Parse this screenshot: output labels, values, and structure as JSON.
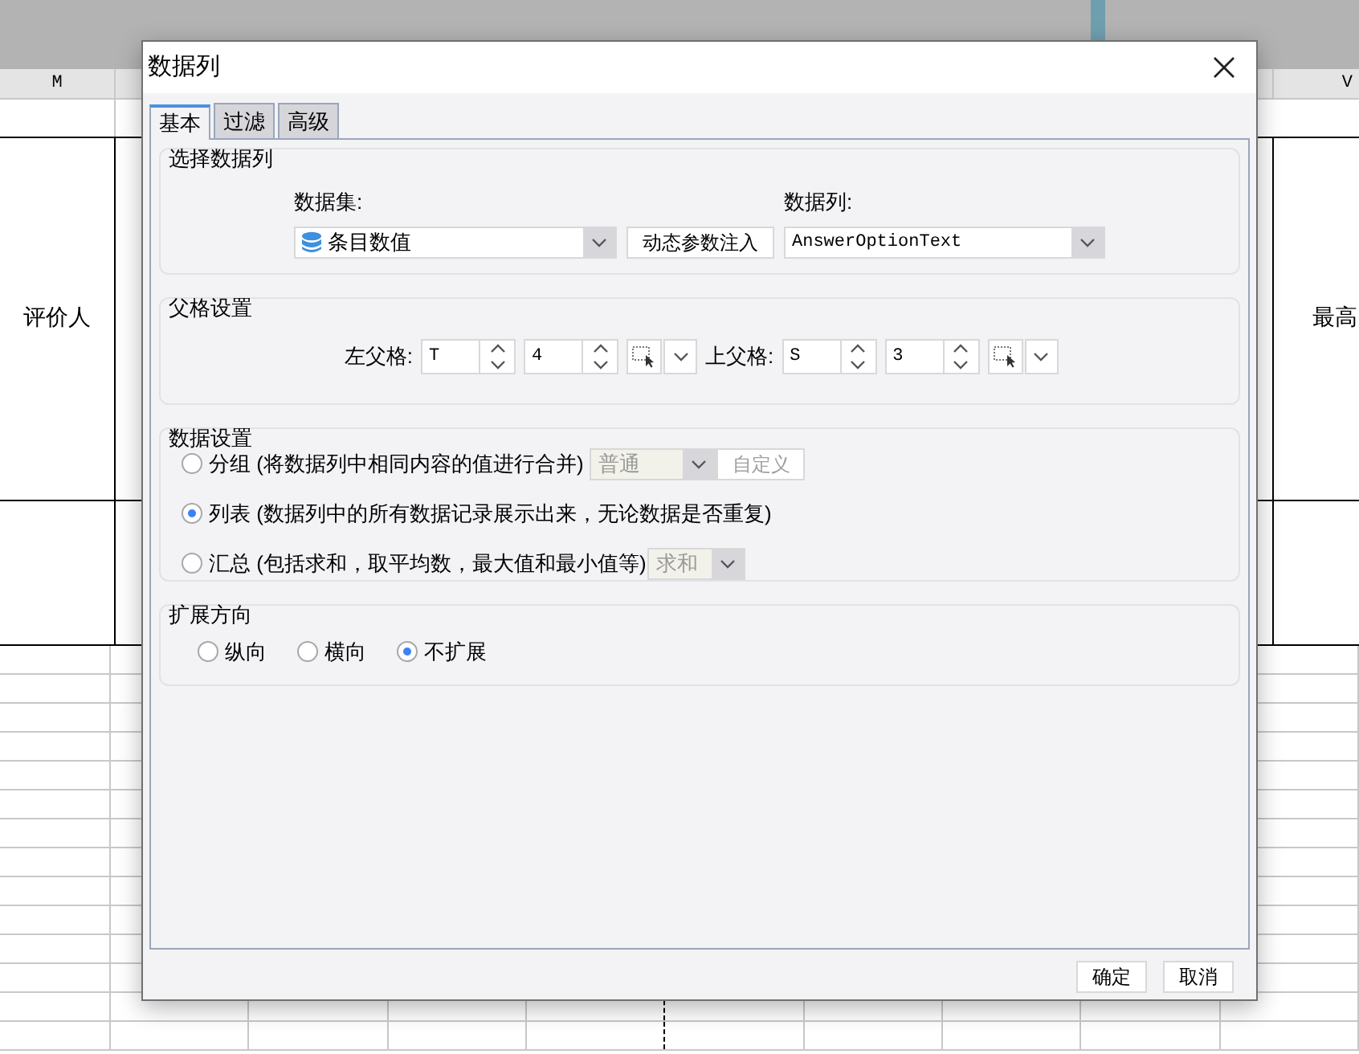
{
  "sheet": {
    "column_headers": [
      "M",
      "V"
    ],
    "cells": [
      "评价人",
      "最高"
    ]
  },
  "dialog": {
    "title": "数据列",
    "tabs": [
      {
        "label": "基本",
        "selected": true
      },
      {
        "label": "过滤",
        "selected": false
      },
      {
        "label": "高级",
        "selected": false
      }
    ],
    "select_column": {
      "title": "选择数据列",
      "dataset_label": "数据集:",
      "dataset_value": "条目数值",
      "inject_button": "动态参数注入",
      "column_label": "数据列:",
      "column_value": "AnswerOptionText"
    },
    "parent_cells": {
      "title": "父格设置",
      "left_label": "左父格:",
      "left_column": "T",
      "left_row": "4",
      "top_label": "上父格:",
      "top_column": "S",
      "top_row": "3"
    },
    "data_settings": {
      "title": "数据设置",
      "options": [
        {
          "kind": "group",
          "label": "分组 (将数据列中相同内容的值进行合并)",
          "selected": false,
          "combo": {
            "value": "普通",
            "disabled": true
          },
          "button": {
            "label": "自定义",
            "disabled": true
          }
        },
        {
          "kind": "list",
          "label": "列表 (数据列中的所有数据记录展示出来，无论数据是否重复)",
          "selected": true
        },
        {
          "kind": "summary",
          "label": "汇总 (包括求和，取平均数，最大值和最小值等)",
          "selected": false,
          "combo": {
            "value": "求和",
            "disabled": true
          }
        }
      ]
    },
    "expand": {
      "title": "扩展方向",
      "options": [
        {
          "label": "纵向",
          "selected": false
        },
        {
          "label": "横向",
          "selected": false
        },
        {
          "label": "不扩展",
          "selected": true
        }
      ]
    },
    "buttons": [
      "确定",
      "取消"
    ]
  }
}
